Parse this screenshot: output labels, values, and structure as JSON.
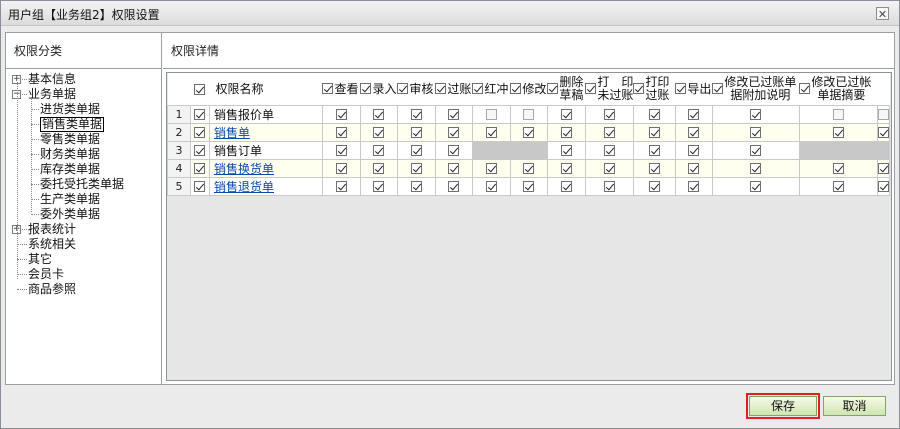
{
  "window": {
    "title": "用户组【业务组2】权限设置",
    "close_glyph": "✕"
  },
  "left": {
    "header": "权限分类",
    "tree": [
      {
        "label": "基本信息",
        "expander": "+"
      },
      {
        "label": "业务单据",
        "expander": "−"
      },
      {
        "label": "进货类单据"
      },
      {
        "label": "销售类单据",
        "selected": true
      },
      {
        "label": "零售类单据"
      },
      {
        "label": "财务类单据"
      },
      {
        "label": "库存类单据"
      },
      {
        "label": "委托受托类单据"
      },
      {
        "label": "生产类单据"
      },
      {
        "label": "委外类单据"
      },
      {
        "label": "报表统计",
        "expander": "+"
      },
      {
        "label": "系统相关"
      },
      {
        "label": "其它"
      },
      {
        "label": "会员卡"
      },
      {
        "label": "商品参照"
      }
    ]
  },
  "right": {
    "header": "权限详情",
    "columns": {
      "name": "权限名称",
      "view": "查看",
      "enter": "录入",
      "audit": "审核",
      "post": "过账",
      "red": "红冲",
      "modify": "修改",
      "delete_draft_1": "删除",
      "delete_draft_2": "草稿",
      "print_unposted_1": "打　印",
      "print_unposted_2": "未过账",
      "print_posted_1": "打印",
      "print_posted_2": "过账",
      "export": "导出",
      "modify_posted_note_1": "修改已过账单",
      "modify_posted_note_2": "据附加说明",
      "modify_posted_summary_1": "修改已过帐",
      "modify_posted_summary_2": "单据摘要"
    },
    "rows": [
      {
        "num": "1",
        "name": "销售报价单",
        "link": false,
        "checked": [
          true,
          true,
          true,
          true,
          false,
          false,
          true,
          true,
          true,
          true,
          true,
          false,
          false
        ],
        "disabled": []
      },
      {
        "num": "2",
        "name": "销售单",
        "link": true,
        "checked": [
          true,
          true,
          true,
          true,
          true,
          true,
          true,
          true,
          true,
          true,
          true,
          true,
          true
        ],
        "disabled": []
      },
      {
        "num": "3",
        "name": "销售订单",
        "link": false,
        "checked": [
          true,
          true,
          true,
          true,
          false,
          false,
          true,
          true,
          true,
          true,
          true,
          false,
          false
        ],
        "disabled": [
          4,
          5,
          11,
          12
        ]
      },
      {
        "num": "4",
        "name": "销售换货单",
        "link": true,
        "checked": [
          true,
          true,
          true,
          true,
          true,
          true,
          true,
          true,
          true,
          true,
          true,
          true,
          true
        ],
        "disabled": []
      },
      {
        "num": "5",
        "name": "销售退货单",
        "link": true,
        "checked": [
          true,
          true,
          true,
          true,
          true,
          true,
          true,
          true,
          true,
          true,
          true,
          true,
          true
        ],
        "disabled": []
      }
    ]
  },
  "buttons": {
    "save": "保存",
    "cancel": "取消"
  }
}
